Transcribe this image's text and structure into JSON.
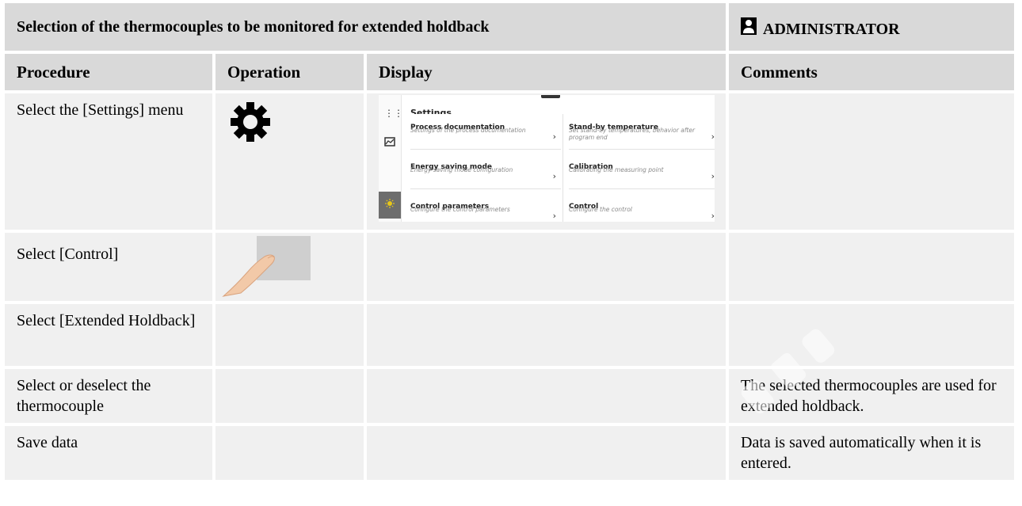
{
  "header": {
    "title": "Selection of the thermocouples to be monitored for extended holdback",
    "role": "ADMINISTRATOR"
  },
  "columns": [
    "Procedure",
    "Operation",
    "Display",
    "Comments"
  ],
  "rows": [
    {
      "procedure": "Select the [Settings] menu",
      "operation_icon": "gear-icon",
      "comment": ""
    },
    {
      "procedure": "Select [Control]",
      "operation_icon": "finger-tap-icon",
      "comment": ""
    },
    {
      "procedure": "Select [Extended Holdback]",
      "comment": ""
    },
    {
      "procedure": "Select or deselect the thermocouple",
      "comment": "The selected thermocouples are used for extended holdback."
    },
    {
      "procedure": "Save data",
      "comment": "Data is saved automatically when it is entered."
    }
  ],
  "settings_screen": {
    "title": "Settings",
    "tiles": [
      {
        "title": "Process documentation",
        "subtitle": "Settings of the process documentation"
      },
      {
        "title": "Stand-by temperature",
        "subtitle": "Set stand-by temperatures, behavior after program end"
      },
      {
        "title": "Energy saving mode",
        "subtitle": "Energy saving mode configuration"
      },
      {
        "title": "Calibration",
        "subtitle": "Calibrating the measuring point"
      },
      {
        "title": "Control parameters",
        "subtitle": "Configure the control parameters"
      },
      {
        "title": "Control",
        "subtitle": "Configure the control"
      }
    ],
    "chevron": "›"
  },
  "colors": {
    "header_bg": "#d9d9d9",
    "cell_bg": "#f0f0f0",
    "accent_active": "#6d6d6d",
    "sun_icon": "#e6c619"
  }
}
